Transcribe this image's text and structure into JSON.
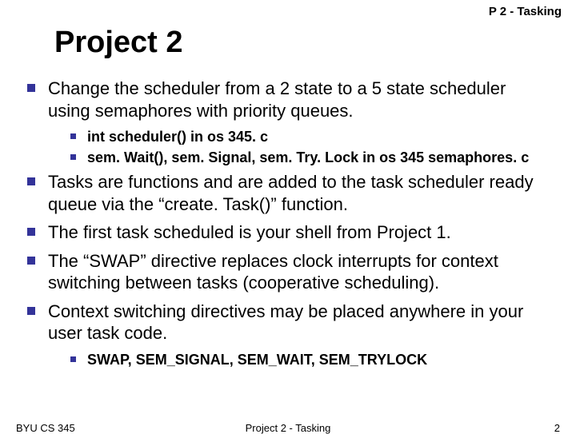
{
  "header_label": "P 2 - Tasking",
  "title": "Project 2",
  "bullets": [
    {
      "text": "Change the scheduler from a 2 state to a 5 state scheduler using semaphores with priority queues.",
      "sub": [
        " int scheduler() in os 345. c",
        " sem. Wait(), sem. Signal, sem. Try. Lock in os 345 semaphores. c"
      ]
    },
    {
      "text": "Tasks are functions and are added to the task scheduler ready queue via the “create. Task()” function."
    },
    {
      "text": "The first task scheduled is your shell from Project 1."
    },
    {
      "text": "The “SWAP” directive replaces clock interrupts for context switching between tasks (cooperative scheduling)."
    },
    {
      "text": "Context switching directives may be placed anywhere in your user task code.",
      "sub": [
        " SWAP, SEM_SIGNAL, SEM_WAIT, SEM_TRYLOCK"
      ]
    }
  ],
  "footer": {
    "left": "BYU CS 345",
    "center": "Project 2 - Tasking",
    "right": "2"
  }
}
